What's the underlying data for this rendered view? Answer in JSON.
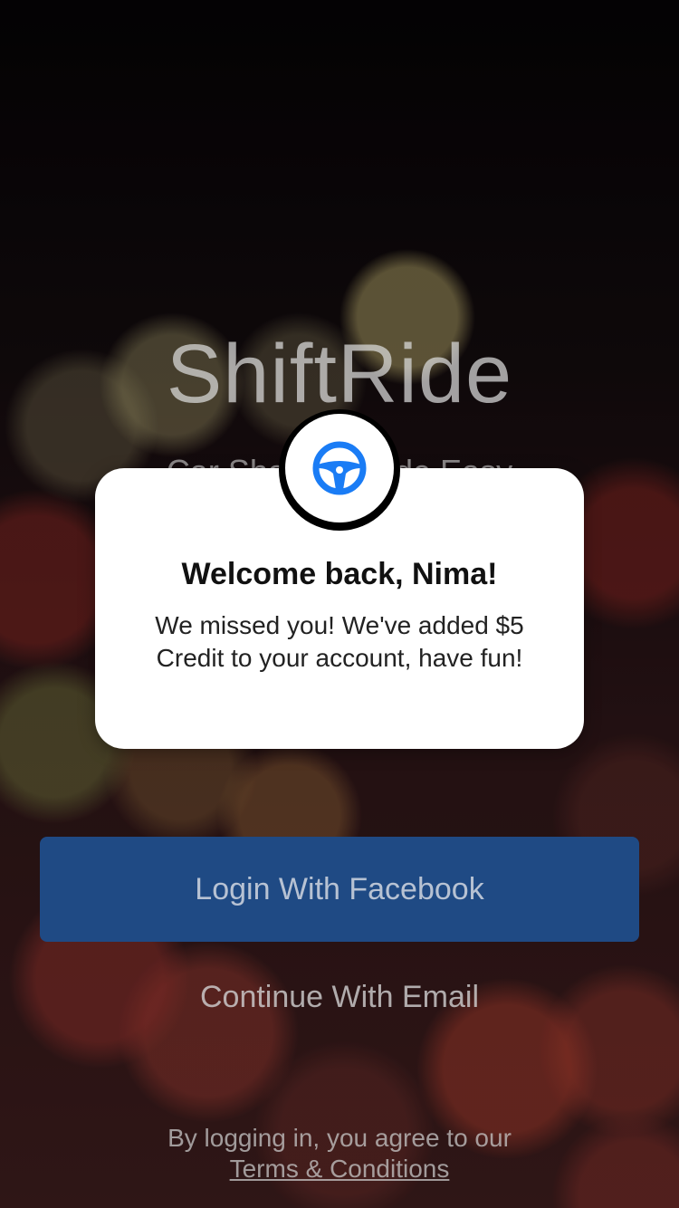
{
  "app": {
    "title": "ShiftRide",
    "tagline": "Car Sharing Made Easy"
  },
  "actions": {
    "facebook_login_label": "Login With Facebook",
    "email_label": "Continue With Email"
  },
  "legal": {
    "prefix": "By logging in, you agree to our",
    "terms_link": "Terms & Conditions"
  },
  "modal": {
    "icon": "steering-wheel-icon",
    "title": "Welcome back, Nima!",
    "message": "We missed you! We've added $5 Credit to your account, have fun!"
  },
  "colors": {
    "facebook_blue": "#1f4a84",
    "icon_blue": "#1a7cf5",
    "modal_background": "#ffffff"
  }
}
